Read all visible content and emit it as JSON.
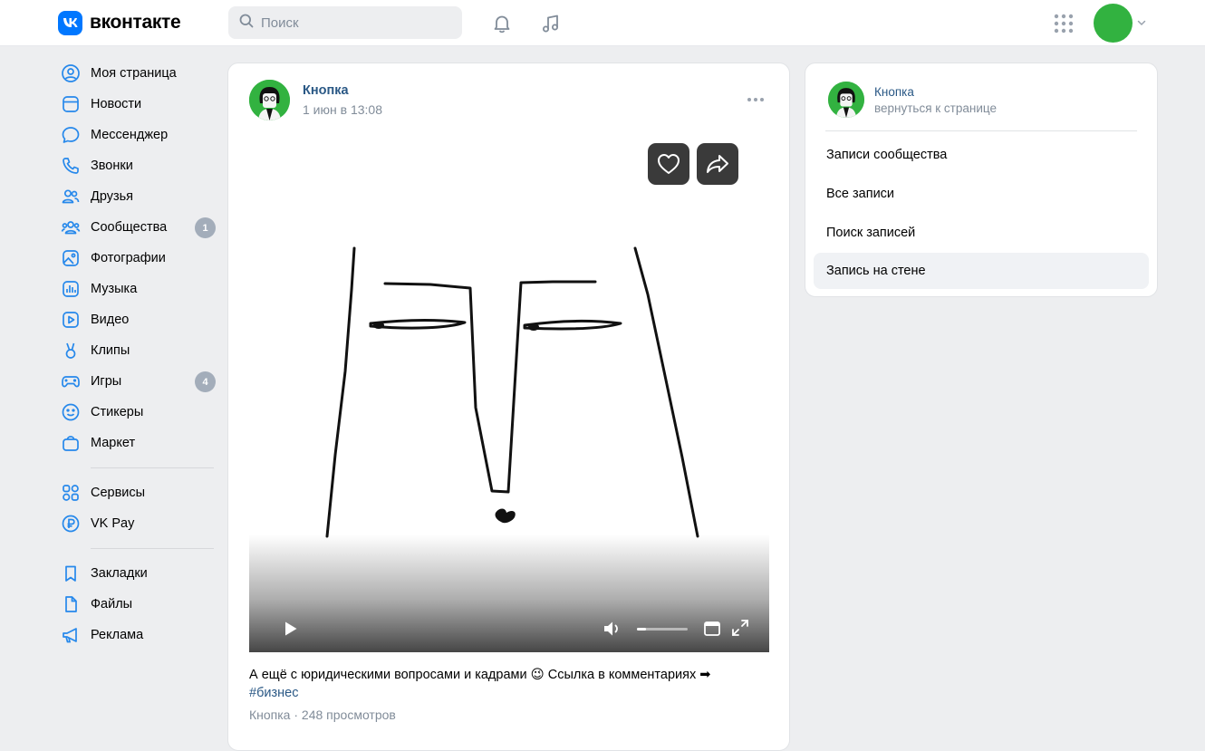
{
  "app": {
    "logo_text": "вконтакте",
    "accent": "#0077ff"
  },
  "search": {
    "placeholder": "Поиск"
  },
  "sidebar": {
    "items": [
      {
        "label": "Моя страница",
        "icon": "user-circle-icon"
      },
      {
        "label": "Новости",
        "icon": "news-icon"
      },
      {
        "label": "Мессенджер",
        "icon": "message-icon"
      },
      {
        "label": "Звонки",
        "icon": "phone-icon"
      },
      {
        "label": "Друзья",
        "icon": "friends-icon"
      },
      {
        "label": "Сообщества",
        "icon": "communities-icon",
        "badge": "1"
      },
      {
        "label": "Фотографии",
        "icon": "photo-icon"
      },
      {
        "label": "Музыка",
        "icon": "music-icon"
      },
      {
        "label": "Видео",
        "icon": "video-icon"
      },
      {
        "label": "Клипы",
        "icon": "clips-icon"
      },
      {
        "label": "Игры",
        "icon": "gamepad-icon",
        "badge": "4"
      },
      {
        "label": "Стикеры",
        "icon": "sticker-icon"
      },
      {
        "label": "Маркет",
        "icon": "market-icon"
      }
    ],
    "items2": [
      {
        "label": "Сервисы",
        "icon": "services-icon"
      },
      {
        "label": "VK Pay",
        "icon": "vkpay-icon"
      }
    ],
    "items3": [
      {
        "label": "Закладки",
        "icon": "bookmark-icon"
      },
      {
        "label": "Файлы",
        "icon": "file-icon"
      },
      {
        "label": "Реклама",
        "icon": "megaphone-icon"
      }
    ]
  },
  "post": {
    "author": "Кнопка",
    "date": "1 июн в 13:08",
    "text": "А ещё с юридическими вопросами и кадрами 😉 Ссылка в комментариях ➡",
    "hashtag": "#бизнес",
    "footer": "Кнопка · 248 просмотров",
    "volume": 0.18
  },
  "right_panel": {
    "name": "Кнопка",
    "back": "вернуться к странице",
    "items": [
      "Записи сообщества",
      "Все записи",
      "Поиск записей",
      "Запись на стене"
    ],
    "active_index": 3
  }
}
